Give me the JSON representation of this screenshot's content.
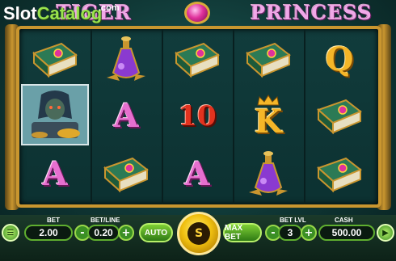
{
  "watermark": {
    "part_a": "Slot",
    "part_b": "Catalog",
    "suffix": ".com"
  },
  "title": {
    "left": "TIGER",
    "right": "PRINCESS"
  },
  "reels": [
    [
      "book",
      "wild",
      "A"
    ],
    [
      "potion",
      "A",
      "book"
    ],
    [
      "book",
      "10",
      "A"
    ],
    [
      "book",
      "K",
      "potion"
    ],
    [
      "Q",
      "book",
      "book"
    ]
  ],
  "controls": {
    "bet_label": "BET",
    "bet_value": "2.00",
    "betline_label": "BET/LINE",
    "betline_value": "0.20",
    "auto_label": "AUTO",
    "spin_label": "S",
    "maxbet_label": "MAX BET",
    "betlvl_label": "BET LVL",
    "betlvl_value": "3",
    "cash_label": "CASH",
    "cash_value": "500.00",
    "minus": "-",
    "plus": "+"
  },
  "colors": {
    "frame": "#c9962f",
    "accent_green": "#5fae2f",
    "spin_gold": "#f0c010"
  }
}
